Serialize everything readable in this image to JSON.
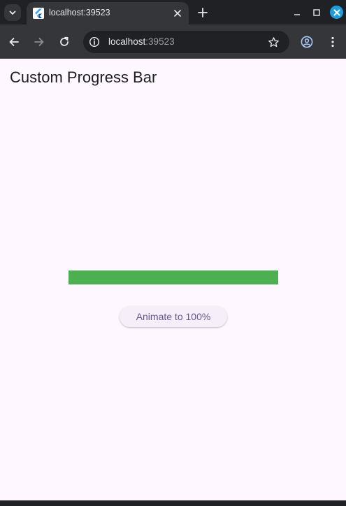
{
  "browser": {
    "tab": {
      "title": "localhost:39523",
      "favicon": "flutter-icon"
    },
    "address_bar": {
      "host": "localhost",
      "port": ":39523"
    },
    "icons": {
      "tab_search": "chevron-down-icon",
      "tab_close": "close-icon",
      "new_tab": "plus-icon",
      "minimize": "minimize-icon",
      "maximize": "maximize-icon",
      "window_close": "close-icon",
      "back": "arrow-left-icon",
      "forward": "arrow-right-icon",
      "reload": "reload-icon",
      "site_info": "info-icon",
      "bookmark": "star-icon",
      "profile": "account-icon",
      "menu": "more-vert-icon"
    }
  },
  "app": {
    "title": "Custom Progress Bar",
    "progress": {
      "value": 1.0,
      "color": "#4caf50",
      "track_color": "#e0e0e0"
    },
    "button": {
      "label": "Animate to 100%"
    }
  },
  "colors": {
    "page_background": "#fef7ff",
    "button_text": "#65558f",
    "browser_frame": "#202124",
    "browser_toolbar": "#35363a"
  }
}
